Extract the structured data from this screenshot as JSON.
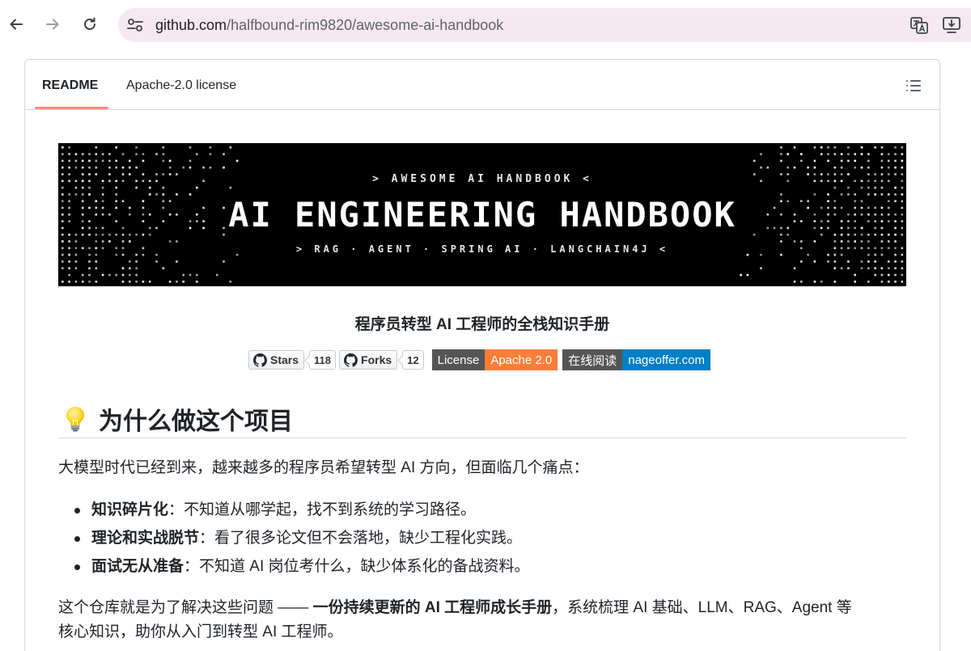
{
  "browser": {
    "url_host": "github.com",
    "url_path": "/halfbound-rim9820/awesome-ai-handbook",
    "icons": [
      "back-icon",
      "forward-icon",
      "reload-icon",
      "site-settings-icon",
      "translate-icon",
      "install-app-icon"
    ]
  },
  "readme_tabs": {
    "readme": "README",
    "license": "Apache-2.0 license"
  },
  "banner": {
    "top": "> AWESOME AI HANDBOOK <",
    "title": "AI ENGINEERING HANDBOOK",
    "bottom": "> RAG · AGENT · SPRING AI · LANGCHAIN4J <"
  },
  "subtitle": "程序员转型 AI 工程师的全栈知识手册",
  "badges": {
    "stars_label": "Stars",
    "stars_count": "118",
    "forks_label": "Forks",
    "forks_count": "12",
    "license_label": "License",
    "license_value": "Apache 2.0",
    "license_color": "#fe7d37",
    "read_label": "在线阅读",
    "read_value": "nageoffer.com",
    "read_color": "#007ec6"
  },
  "section": {
    "title": "为什么做这个项目",
    "intro": "大模型时代已经到来，越来越多的程序员希望转型 AI 方向，但面临几个痛点：",
    "points": [
      {
        "bold": "知识碎片化",
        "text": "：不知道从哪学起，找不到系统的学习路径。"
      },
      {
        "bold": "理论和实战脱节",
        "text": "：看了很多论文但不会落地，缺少工程化实践。"
      },
      {
        "bold": "面试无从准备",
        "text": "：不知道 AI 岗位考什么，缺少体系化的备战资料。"
      }
    ],
    "closing_pre": "这个仓库就是为了解决这些问题 —— ",
    "closing_bold": "一份持续更新的 AI 工程师成长手册",
    "closing_post": "，系统梳理 AI 基础、LLM、RAG、Agent 等",
    "closing_line2": "核心知识，助你从入门到转型 AI 工程师。"
  }
}
